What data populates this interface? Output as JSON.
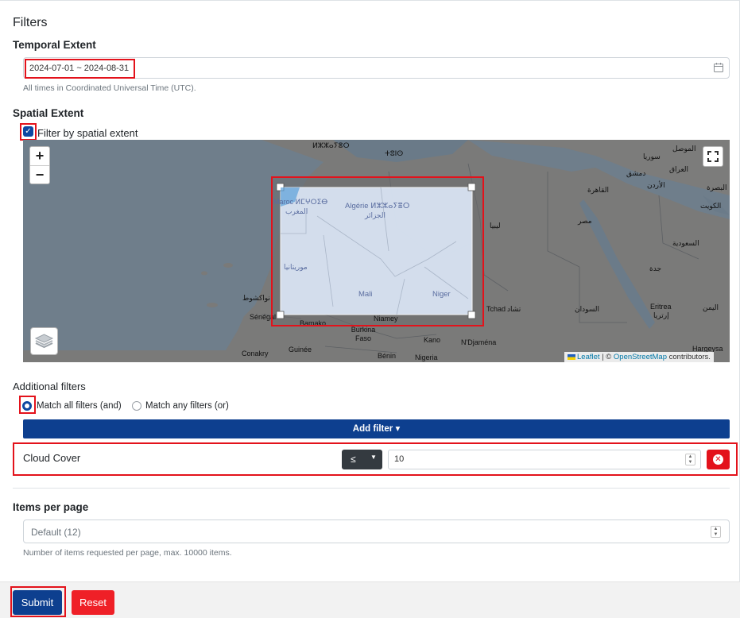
{
  "filters": {
    "heading": "Filters",
    "temporal": {
      "heading": "Temporal Extent",
      "value": "2024-07-01 ~ 2024-08-31",
      "help": "All times in Coordinated Universal Time (UTC).",
      "icon": "calendar-icon"
    },
    "spatial": {
      "heading": "Spatial Extent",
      "checkbox_label": "Filter by spatial extent",
      "checked": true,
      "map": {
        "zoom_in": "+",
        "zoom_out": "−",
        "attribution": {
          "leaflet": "Leaflet",
          "sep": " | © ",
          "osm": "OpenStreetMap",
          "suffix": " contributors."
        },
        "labels": [
          "Maroc ⵍⵎⵖⵔⵉⴱ",
          "المغرب",
          "Algérie ⵍⵣⵣⴰⵢⴻⵔ",
          "الجزائر",
          "موريتانيا",
          "Mali",
          "Niger",
          "Niamey",
          "Burkina Faso",
          "Tchad",
          "تشاد",
          "السودان",
          "مصر",
          "ليبيا",
          "Eritrea",
          "إرتريا",
          "Sénégal",
          "Guinée",
          "Conakry",
          "Kano",
          "N'Djaména",
          "Nigeria",
          "Bénin",
          "سوريا",
          "العراق",
          "الأردن",
          "القاهرة",
          "دمشق",
          "الموصل",
          "البصرة",
          "الكويت",
          "السعودية",
          "جدة",
          "اليمن",
          "Hargeysa",
          "نواكشوط",
          "Bamako",
          "ⵜⵓⵏⵙ",
          "ⵍⵣⵣⴰⵢⴻⵔ"
        ]
      }
    },
    "additional": {
      "heading": "Additional filters",
      "match_all": "Match all filters (and)",
      "match_any": "Match any filters (or)",
      "selected": "and",
      "add_filter_label": "Add filter ▾",
      "rows": [
        {
          "label": "Cloud Cover",
          "operator": "≤",
          "value": "10"
        }
      ]
    },
    "items_per_page": {
      "heading": "Items per page",
      "placeholder": "Default (12)",
      "help": "Number of items requested per page, max. 10000 items."
    }
  },
  "actions": {
    "submit": "Submit",
    "reset": "Reset"
  },
  "colors": {
    "primary": "#0d3f8f",
    "danger": "#e3121b",
    "highlight": "#e3121b"
  }
}
